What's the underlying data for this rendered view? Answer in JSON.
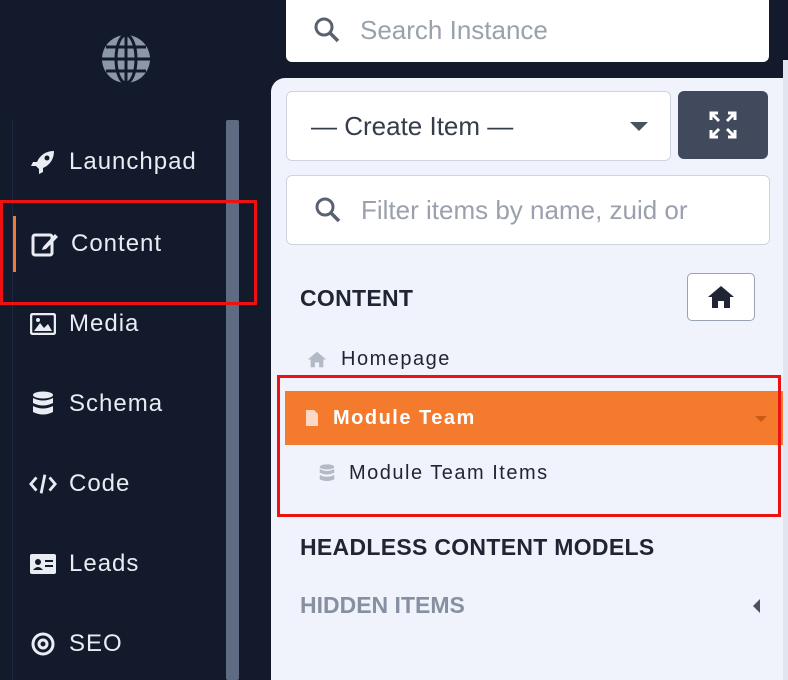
{
  "sidebar": {
    "logo_icon": "globe-icon",
    "items": [
      {
        "label": "Launchpad",
        "icon": "rocket-icon"
      },
      {
        "label": "Content",
        "icon": "edit-icon",
        "active": true
      },
      {
        "label": "Media",
        "icon": "image-icon"
      },
      {
        "label": "Schema",
        "icon": "database-icon"
      },
      {
        "label": "Code",
        "icon": "code-icon"
      },
      {
        "label": "Leads",
        "icon": "id-card-icon"
      },
      {
        "label": "SEO",
        "icon": "target-icon"
      }
    ]
  },
  "search": {
    "placeholder": "Search Instance"
  },
  "content_panel": {
    "create_item_label": "— Create Item —",
    "filter_placeholder": "Filter items by name, zuid or",
    "section_content": "CONTENT",
    "tree": {
      "homepage": "Homepage",
      "active_item": "Module Team",
      "sub_item": "Module Team Items"
    },
    "section_headless": "HEADLESS CONTENT MODELS",
    "section_hidden": "HIDDEN ITEMS"
  },
  "colors": {
    "sidebar_bg": "#121a2b",
    "accent": "#f47b2d",
    "panel_bg": "#f0f3fb",
    "highlight": "#ee1111"
  }
}
